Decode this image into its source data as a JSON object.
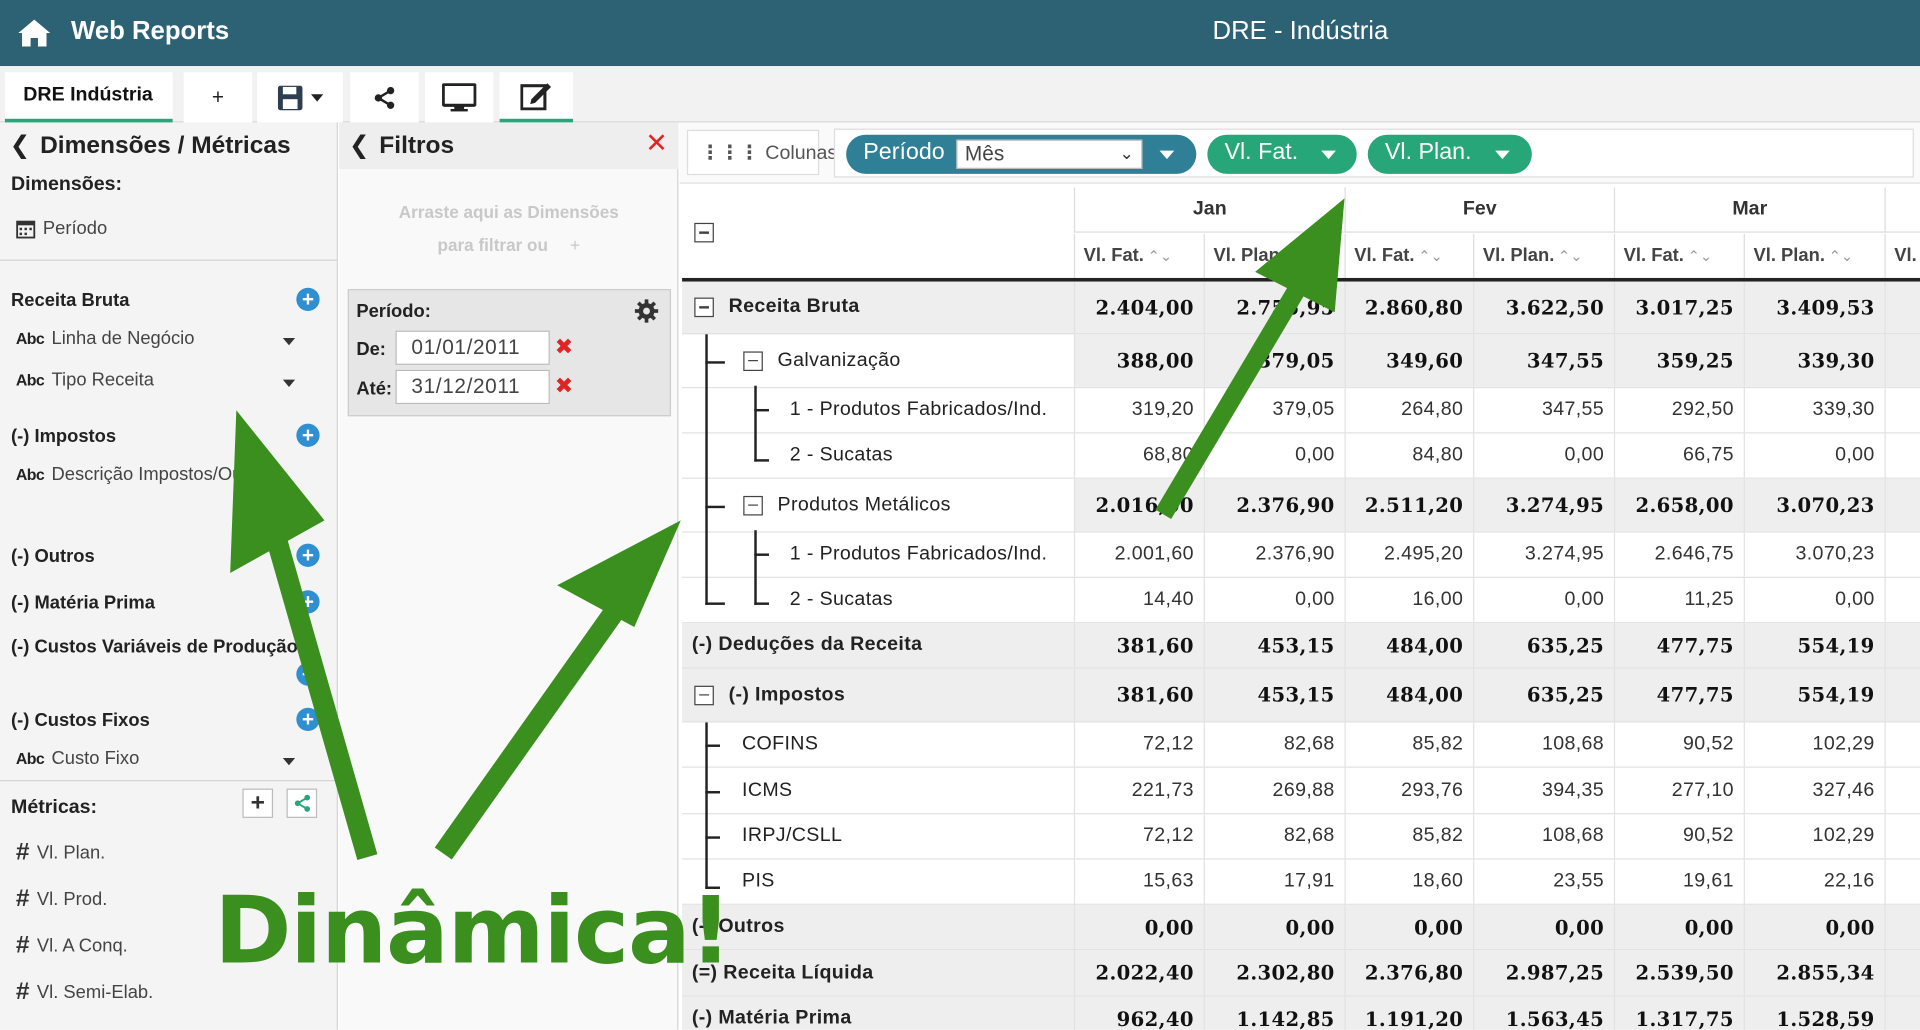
{
  "header": {
    "app_title": "Web Reports",
    "doc_title": "DRE - Indústria"
  },
  "tabs": {
    "active_label": "DRE Indústria",
    "add_label": "+"
  },
  "left_panel": {
    "title": "Dimensões / Métricas",
    "dimensions_label": "Dimensões:",
    "period_item": "Período",
    "groups": {
      "receita_bruta": "Receita Bruta",
      "linha_negocio": "Linha de Negócio",
      "tipo_receita": "Tipo Receita",
      "impostos": "(-) Impostos",
      "descricao_impostos": "Descrição Impostos/Outros",
      "outros": "(-) Outros",
      "materia_prima": "(-) Matéria Prima",
      "custos_variaveis": "(-) Custos Variáveis de Produção",
      "custos_fixos": "(-) Custos Fixos",
      "custo_fixo": "Custo Fixo"
    },
    "metrics_label": "Métricas:",
    "metrics": [
      "Vl. Plan.",
      "Vl. Prod.",
      "Vl. A Conq.",
      "Vl. Semi-Elab."
    ]
  },
  "filters": {
    "title": "Filtros",
    "drop_hint_1": "Arraste aqui as Dimensões",
    "drop_hint_2": "para filtrar ou",
    "period_label": "Período:",
    "from_label": "De:",
    "to_label": "Até:",
    "from_value": "01/01/2011",
    "to_value": "31/12/2011"
  },
  "columns_bar": {
    "label": "Colunas:",
    "pill_period": "Período",
    "period_select": "Mês",
    "pill_fat": "Vl. Fat.",
    "pill_plan": "Vl. Plan."
  },
  "grid": {
    "months": [
      "Jan",
      "Fev",
      "Mar"
    ],
    "sub_headers": [
      "Vl. Fat.",
      "Vl. Plan.",
      "Vl. Fat.",
      "Vl. Plan.",
      "Vl. Fat.",
      "Vl. Plan.",
      "Vl."
    ],
    "rows": [
      {
        "label": "Receita Bruta",
        "values": [
          "2.404,00",
          "2.755,95",
          "2.860,80",
          "3.622,50",
          "3.017,25",
          "3.409,53"
        ]
      },
      {
        "label": "Galvanização",
        "values": [
          "388,00",
          "379,05",
          "349,60",
          "347,55",
          "359,25",
          "339,30"
        ]
      },
      {
        "label": "1 - Produtos Fabricados/Ind.",
        "values": [
          "319,20",
          "379,05",
          "264,80",
          "347,55",
          "292,50",
          "339,30"
        ]
      },
      {
        "label": "2 - Sucatas",
        "values": [
          "68,80",
          "0,00",
          "84,80",
          "0,00",
          "66,75",
          "0,00"
        ]
      },
      {
        "label": "Produtos Metálicos",
        "values": [
          "2.016,00",
          "2.376,90",
          "2.511,20",
          "3.274,95",
          "2.658,00",
          "3.070,23"
        ]
      },
      {
        "label": "1 - Produtos Fabricados/Ind.",
        "values": [
          "2.001,60",
          "2.376,90",
          "2.495,20",
          "3.274,95",
          "2.646,75",
          "3.070,23"
        ]
      },
      {
        "label": "2 - Sucatas",
        "values": [
          "14,40",
          "0,00",
          "16,00",
          "0,00",
          "11,25",
          "0,00"
        ]
      },
      {
        "label": "(-) Deduções da Receita",
        "values": [
          "381,60",
          "453,15",
          "484,00",
          "635,25",
          "477,75",
          "554,19"
        ]
      },
      {
        "label": "(-) Impostos",
        "values": [
          "381,60",
          "453,15",
          "484,00",
          "635,25",
          "477,75",
          "554,19"
        ]
      },
      {
        "label": "COFINS",
        "values": [
          "72,12",
          "82,68",
          "85,82",
          "108,68",
          "90,52",
          "102,29"
        ]
      },
      {
        "label": "ICMS",
        "values": [
          "221,73",
          "269,88",
          "293,76",
          "394,35",
          "277,10",
          "327,46"
        ]
      },
      {
        "label": "IRPJ/CSLL",
        "values": [
          "72,12",
          "82,68",
          "85,82",
          "108,68",
          "90,52",
          "102,29"
        ]
      },
      {
        "label": "PIS",
        "values": [
          "15,63",
          "17,91",
          "18,60",
          "23,55",
          "19,61",
          "22,16"
        ]
      },
      {
        "label": "(-) Outros",
        "values": [
          "0,00",
          "0,00",
          "0,00",
          "0,00",
          "0,00",
          "0,00"
        ]
      },
      {
        "label": "(=) Receita Líquida",
        "values": [
          "2.022,40",
          "2.302,80",
          "2.376,80",
          "2.987,25",
          "2.539,50",
          "2.855,34"
        ]
      },
      {
        "label": "(-) Matéria Prima",
        "values": [
          "962,40",
          "1.142,85",
          "1.191,20",
          "1.563,45",
          "1.317,75",
          "1.528,59"
        ]
      }
    ]
  },
  "overlay": {
    "text": "Dinâmica!"
  },
  "colors": {
    "header_bg": "#2d6275",
    "pill_bg": "#2f8096",
    "pill_green": "#27a779",
    "accent_green": "#3a8f1e",
    "danger": "#e02424"
  }
}
